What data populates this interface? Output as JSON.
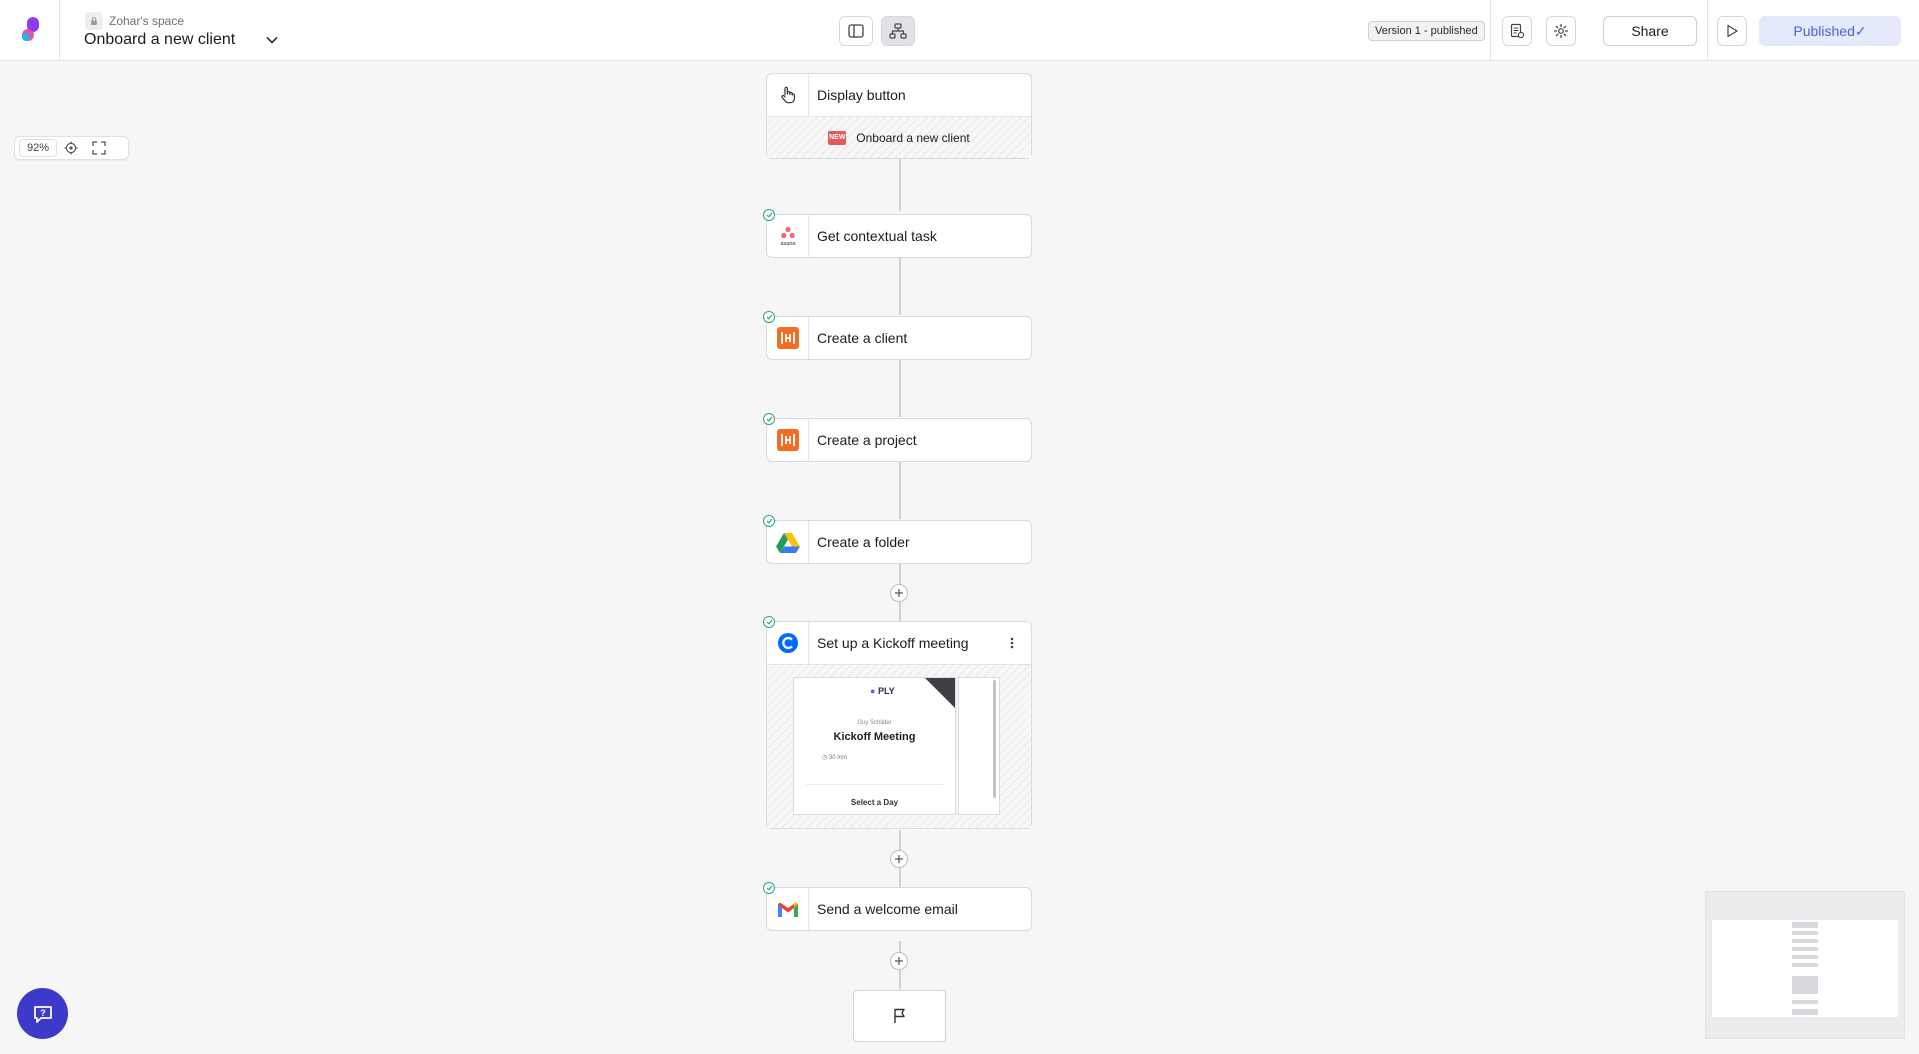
{
  "header": {
    "space_name": "Zohar's space",
    "flow_title": "Onboard a new client",
    "version_label": "Version 1 - published",
    "share_label": "Share",
    "published_label": "Published✓"
  },
  "canvas": {
    "zoom_label": "92%"
  },
  "flow": {
    "trigger": {
      "label": "Display button",
      "subtitle": "Onboard a new client",
      "badge": "NEW",
      "icon": "hand-pointer-icon"
    },
    "steps": [
      {
        "label": "Get contextual task",
        "icon": "asana-icon",
        "completed": true
      },
      {
        "label": "Create a client",
        "icon": "harvest-icon",
        "completed": true
      },
      {
        "label": "Create a project",
        "icon": "harvest-icon",
        "completed": true
      },
      {
        "label": "Create a folder",
        "icon": "google-drive-icon",
        "completed": true
      },
      {
        "label": "Set up a Kickoff meeting",
        "icon": "calendly-icon",
        "completed": true
      },
      {
        "label": "Send a welcome email",
        "icon": "gmail-icon",
        "completed": true
      }
    ],
    "preview": {
      "brand": "PLY",
      "owner": "Guy Schlider",
      "title": "Kickoff Meeting",
      "duration": "30 min",
      "cta": "Select a Day"
    },
    "end_icon": "flag-icon"
  },
  "colors": {
    "accent": "#4a63d8",
    "help_button": "#3d39c9",
    "success": "#2ba774",
    "harvest": "#f36c24"
  }
}
